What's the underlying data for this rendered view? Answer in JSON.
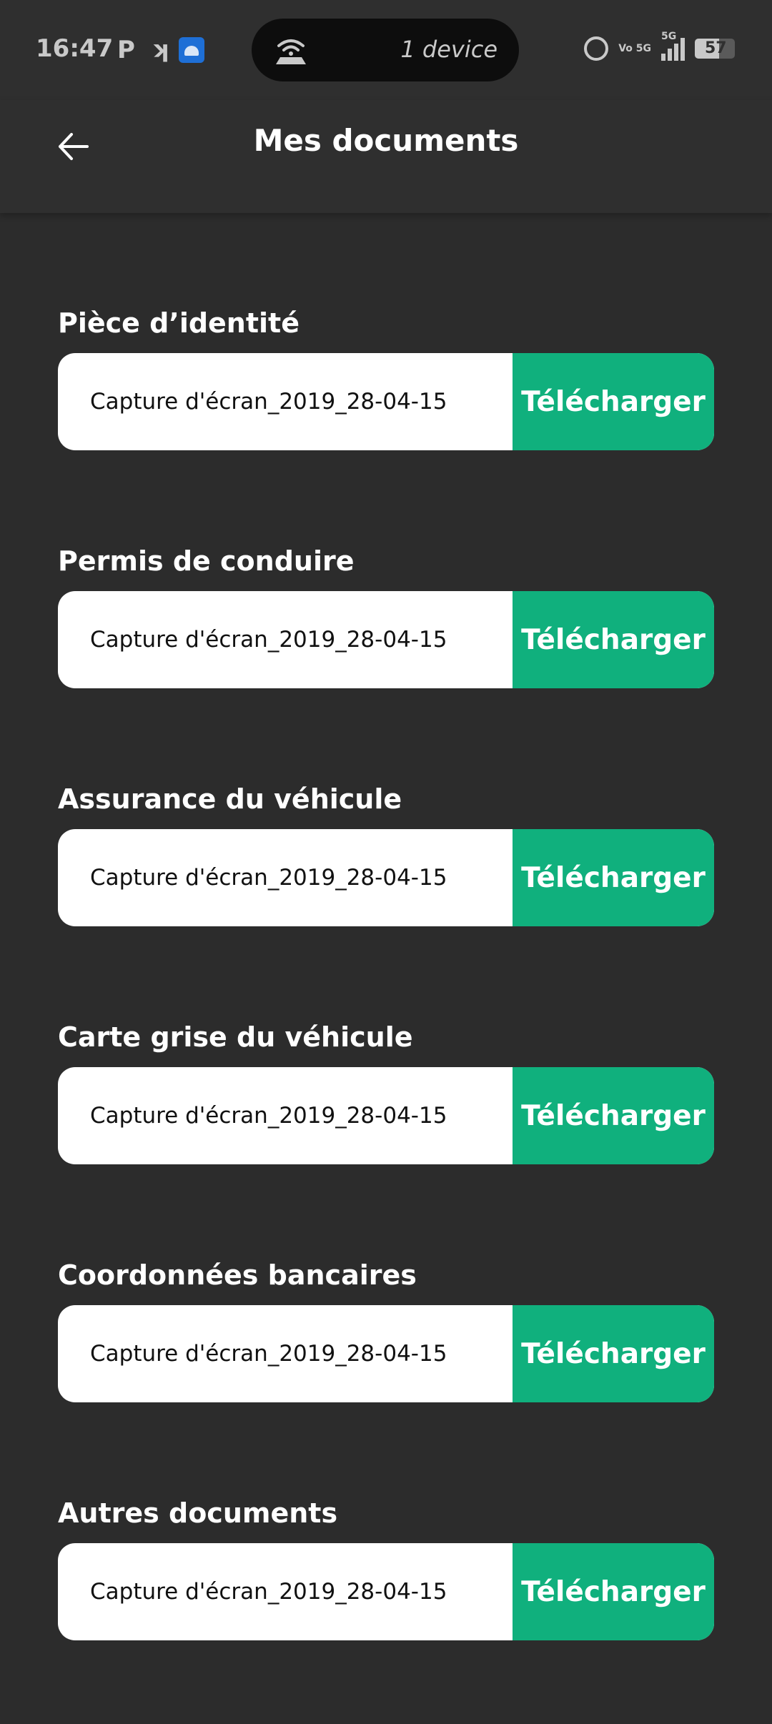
{
  "status_bar": {
    "time": "16:47",
    "pill_text": "1 device",
    "signal_label": "5G",
    "volte_label": "Vo 5G",
    "battery_level": "57",
    "icons": [
      "p-icon",
      "k-icon",
      "android-icon",
      "hotspot-icon",
      "alarm-icon",
      "signal-icon",
      "battery-icon"
    ]
  },
  "header": {
    "title": "Mes documents",
    "back_icon": "arrow-left-icon"
  },
  "documents": [
    {
      "label": "Pièce d’identité",
      "file": "Capture d'écran_2019_28-04-15",
      "button": "Télécharger"
    },
    {
      "label": "Permis de conduire",
      "file": "Capture d'écran_2019_28-04-15",
      "button": "Télécharger"
    },
    {
      "label": "Assurance du véhicule",
      "file": "Capture d'écran_2019_28-04-15",
      "button": "Télécharger"
    },
    {
      "label": "Carte grise du véhicule",
      "file": "Capture d'écran_2019_28-04-15",
      "button": "Télécharger"
    },
    {
      "label": "Coordonnées bancaires",
      "file": "Capture d'écran_2019_28-04-15",
      "button": "Télécharger"
    },
    {
      "label": "Autres documents",
      "file": "Capture d'écran_2019_28-04-15",
      "button": "Télécharger"
    }
  ],
  "colors": {
    "background": "#2c2c2c",
    "accent": "#10b07d",
    "field": "#ffffff"
  }
}
